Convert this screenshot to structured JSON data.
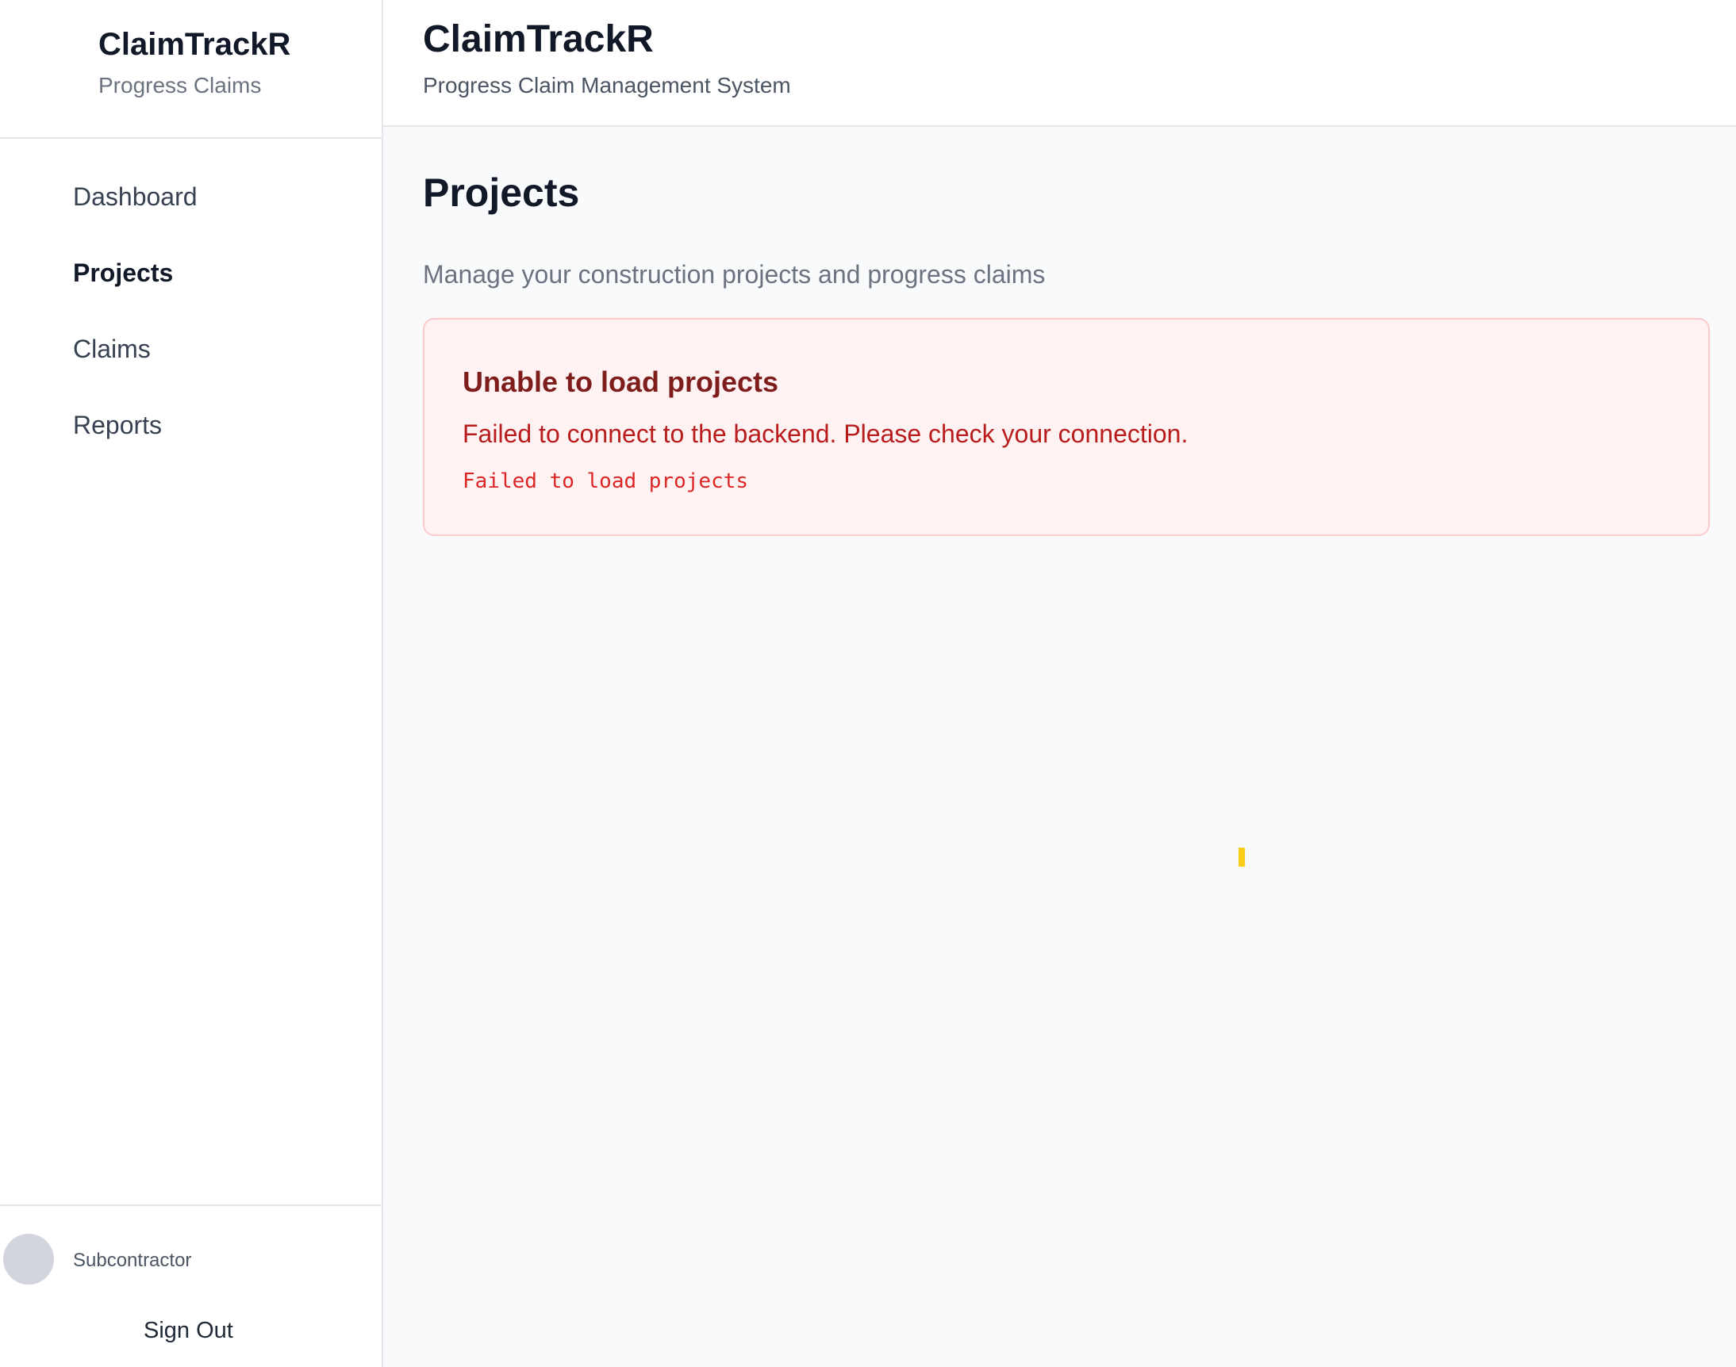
{
  "sidebar": {
    "brand_title": "ClaimTrackR",
    "brand_subtitle": "Progress Claims",
    "nav": [
      {
        "label": "Dashboard"
      },
      {
        "label": "Projects"
      },
      {
        "label": "Claims"
      },
      {
        "label": "Reports"
      }
    ],
    "active_item": "Projects",
    "user": {
      "role": "Subcontractor",
      "signout_label": "Sign Out"
    }
  },
  "header": {
    "title": "ClaimTrackR",
    "subtitle": "Progress Claim Management System"
  },
  "main": {
    "title": "Projects",
    "description": "Manage your construction projects and progress claims",
    "error": {
      "title": "Unable to load projects",
      "message": "Failed to connect to the backend. Please check your connection.",
      "detail": "Failed to load projects"
    }
  },
  "colors": {
    "error_background": "#fef2f2",
    "error_border": "#fecaca",
    "error_title": "#7f1d1d",
    "error_text": "#b91c1c",
    "page_background": "#f9fafb",
    "sidebar_background": "#ffffff"
  }
}
